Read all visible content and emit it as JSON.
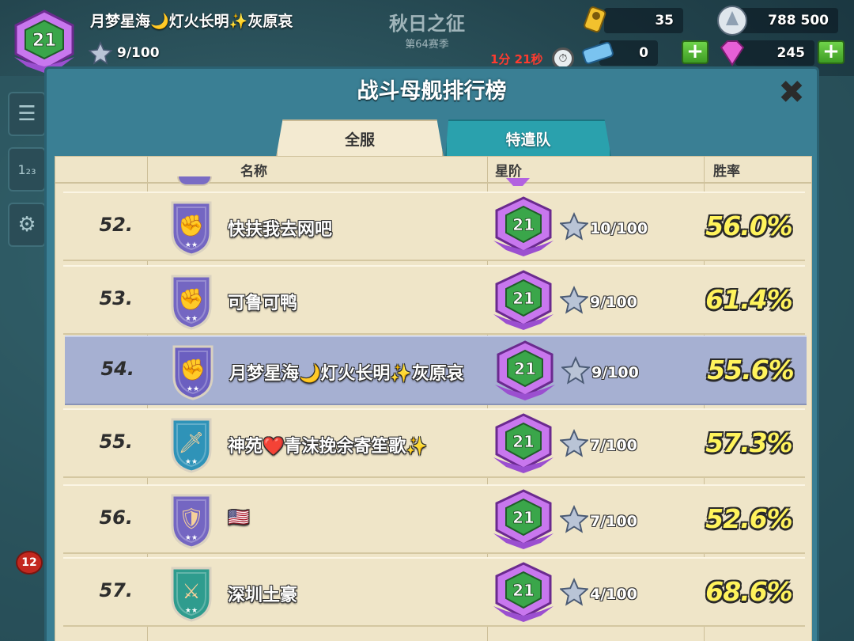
{
  "hud": {
    "level": "21",
    "player_name": "月梦星海🌙灯火长明✨灰原哀",
    "stars": "9/100",
    "event_title": "秋日之征",
    "event_subtitle": "第64赛季",
    "timer": "1分 21秒",
    "resources": {
      "keys": "35",
      "iron": "788 500",
      "tickets": "0",
      "gems": "245"
    },
    "plus_symbol": "+"
  },
  "background": {
    "badge_count": "12"
  },
  "panel": {
    "title": "战斗母舰排行榜",
    "close_symbol": "✖",
    "tabs": [
      {
        "label": "全服",
        "active": true
      },
      {
        "label": "特遣队",
        "active": false
      }
    ],
    "columns": {
      "name": "名称",
      "tier": "星阶",
      "winrate": "胜率"
    }
  },
  "leaderboard": [
    {
      "rank": "52.",
      "name": "快扶我去网吧",
      "level": "21",
      "stars": "10/100",
      "winrate": "56.0%",
      "badge_color": "#7466c2",
      "badge_icon": "fist-icon",
      "self": false
    },
    {
      "rank": "53.",
      "name": "可鲁可鸭",
      "level": "21",
      "stars": "9/100",
      "winrate": "61.4%",
      "badge_color": "#7466c2",
      "badge_icon": "fist-icon",
      "self": false
    },
    {
      "rank": "54.",
      "name": "月梦星海🌙灯火长明✨灰原哀",
      "level": "21",
      "stars": "9/100",
      "winrate": "55.6%",
      "badge_color": "#6b5fc0",
      "badge_icon": "fist-icon",
      "self": true
    },
    {
      "rank": "55.",
      "name": "神苑❤️青沫挽余寄笙歌✨",
      "level": "21",
      "stars": "7/100",
      "winrate": "57.3%",
      "badge_color": "#2f93b8",
      "badge_icon": "dagger-icon",
      "self": false
    },
    {
      "rank": "56.",
      "name": "🇺🇸",
      "level": "21",
      "stars": "7/100",
      "winrate": "52.6%",
      "badge_color": "#7466c2",
      "badge_icon": "winged-shield-icon",
      "self": false
    },
    {
      "rank": "57.",
      "name": "深圳土豪",
      "level": "21",
      "stars": "4/100",
      "winrate": "68.6%",
      "badge_color": "#2f9c8e",
      "badge_icon": "crossed-rifles-icon",
      "self": false
    }
  ],
  "colors": {
    "panel_teal": "#3a7f94",
    "sheet_parchment": "#efe5c8",
    "self_row": "#a6b0d2",
    "winrate_yellow": "#fff35c",
    "level_hex_purple": "#b362e0",
    "level_hex_green": "#3aa64a"
  }
}
